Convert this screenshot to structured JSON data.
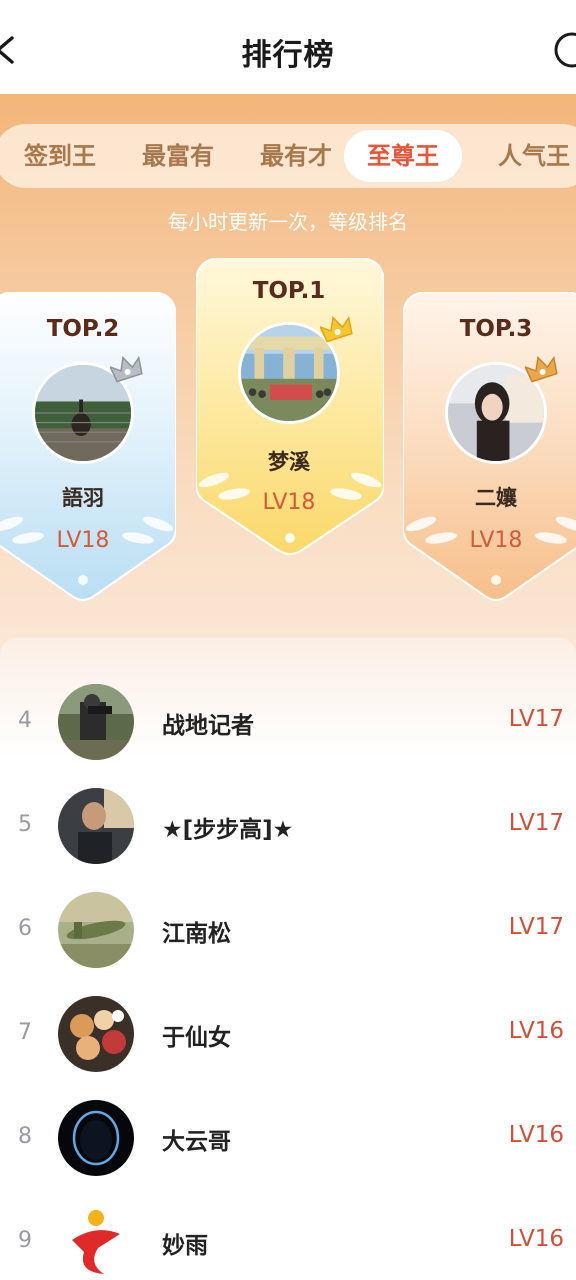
{
  "header": {
    "title": "排行榜",
    "back_icon": "chevron-left-icon",
    "help_icon": "help-circle-icon"
  },
  "tabs": [
    {
      "label": "签到王",
      "active": false
    },
    {
      "label": "最富有",
      "active": false
    },
    {
      "label": "最有才",
      "active": false
    },
    {
      "label": "至尊王",
      "active": true
    },
    {
      "label": "人气王",
      "active": false
    }
  ],
  "subtitle": "每小时更新一次，等级排名",
  "podium": [
    {
      "rank": "TOP.2",
      "name": "語羽",
      "level": "LV18",
      "crown": "silver-crown-icon"
    },
    {
      "rank": "TOP.1",
      "name": "梦溪",
      "level": "LV18",
      "crown": "gold-crown-icon"
    },
    {
      "rank": "TOP.3",
      "name": "二孃",
      "level": "LV18",
      "crown": "bronze-crown-icon"
    }
  ],
  "list": [
    {
      "rank": "4",
      "name": "战地记者",
      "level": "LV17"
    },
    {
      "rank": "5",
      "name": "★[步步高]★",
      "level": "LV17"
    },
    {
      "rank": "6",
      "name": "江南松",
      "level": "LV17"
    },
    {
      "rank": "7",
      "name": "于仙女",
      "level": "LV16"
    },
    {
      "rank": "8",
      "name": "大云哥",
      "level": "LV16"
    },
    {
      "rank": "9",
      "name": "妙雨",
      "level": "LV16"
    }
  ],
  "colors": {
    "accent": "#e8563a",
    "level": "#d0503a",
    "banner_top": "#f3b57a",
    "card_silver": "#bfe2f4",
    "card_gold": "#fbdf7e",
    "card_bronze": "#f8c79a"
  }
}
